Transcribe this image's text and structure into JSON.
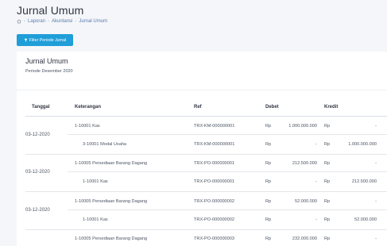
{
  "page": {
    "title": "Jurnal Umum",
    "breadcrumb": [
      "Laporan",
      "Akuntansi",
      "Jurnal Umum"
    ],
    "breadcrumb_sep": "-"
  },
  "filter_button": {
    "label": "Filter Periode Jurnal",
    "icon": "filter-icon"
  },
  "card": {
    "title": "Jurnal Umum",
    "subtitle": "Periode Desember 2020"
  },
  "table": {
    "headers": {
      "tanggal": "Tanggal",
      "keterangan": "Keterangan",
      "ref": "Ref",
      "debet": "Debet",
      "kredit": "Kredit"
    },
    "currency": "Rp",
    "groups": [
      {
        "date": "03-12-2020",
        "rows": [
          {
            "keterangan": "1-10001 Kas",
            "ref": "TRX-KM-000000001",
            "debet": "1.000.000.000",
            "kredit": "-"
          },
          {
            "keterangan": "3-10001 Modal Usaha",
            "ref": "TRX-KM-000000001",
            "debet": "-",
            "kredit": "1.000.000.000"
          }
        ]
      },
      {
        "date": "03-12-2020",
        "rows": [
          {
            "keterangan": "1-10005 Persediaan Barang Dagang",
            "ref": "TRX-PO-000000001",
            "debet": "212.500.000",
            "kredit": "-"
          },
          {
            "keterangan": "1-10001 Kas",
            "ref": "TRX-PO-000000001",
            "debet": "-",
            "kredit": "212.500.000"
          }
        ]
      },
      {
        "date": "03-12-2020",
        "rows": [
          {
            "keterangan": "1-10005 Persediaan Barang Dagang",
            "ref": "TRX-PO-000000002",
            "debet": "52.000.000",
            "kredit": "-"
          },
          {
            "keterangan": "1-10001 Kas",
            "ref": "TRX-PO-000000002",
            "debet": "-",
            "kredit": "52.000.000"
          }
        ]
      },
      {
        "date": "",
        "rows": [
          {
            "keterangan": "1-10005 Persediaan Barang Dagang",
            "ref": "TRX-PO-000000003",
            "debet": "232.000.000",
            "kredit": "-"
          }
        ]
      }
    ]
  },
  "colors": {
    "accent": "#1f9ed8",
    "link": "#5b7bb0",
    "background": "#f4f6f9"
  }
}
